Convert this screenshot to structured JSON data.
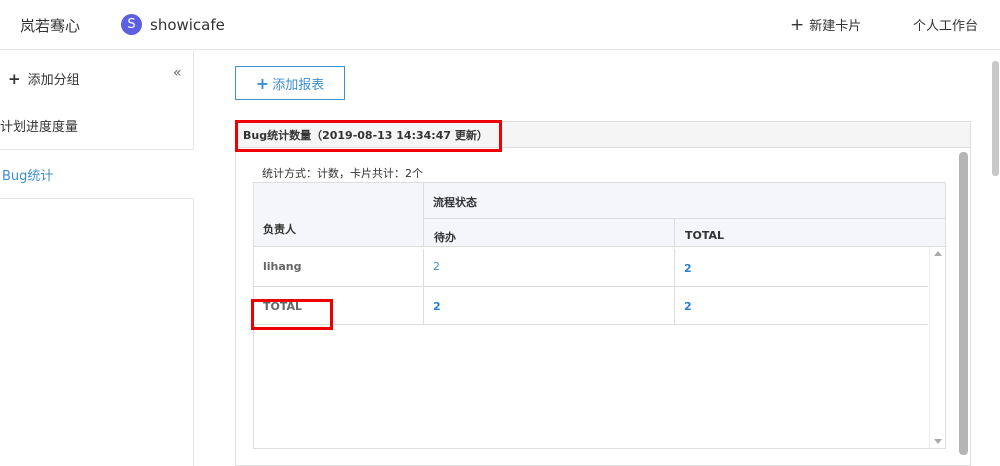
{
  "topbar": {
    "brand": "岚若骞心",
    "project_initial": "S",
    "project_name": "showicafe",
    "new_card_label": "新建卡片",
    "workbench_label": "个人工作台"
  },
  "sidebar": {
    "add_group_label": "添加分组",
    "collapse_glyph": "«",
    "items": [
      {
        "label": "计划进度度量"
      },
      {
        "label": "Bug统计"
      }
    ]
  },
  "main": {
    "add_report_label": "添加报表",
    "report": {
      "title": "Bug统计数量（2019-08-13 14:34:47 更新）",
      "stat_info": "统计方式：计数，卡片共计：2个",
      "headers": {
        "owner": "负责人",
        "status_group": "流程状态",
        "pending": "待办",
        "total": "TOTAL"
      },
      "rows": [
        {
          "owner": "lihang",
          "pending": "2",
          "total": "2"
        },
        {
          "owner": "TOTAL",
          "pending": "2",
          "total": "2"
        }
      ]
    }
  },
  "colors": {
    "accent": "#3c8fd0",
    "highlight": "#ee0000",
    "avatar": "#5b5fe0"
  }
}
